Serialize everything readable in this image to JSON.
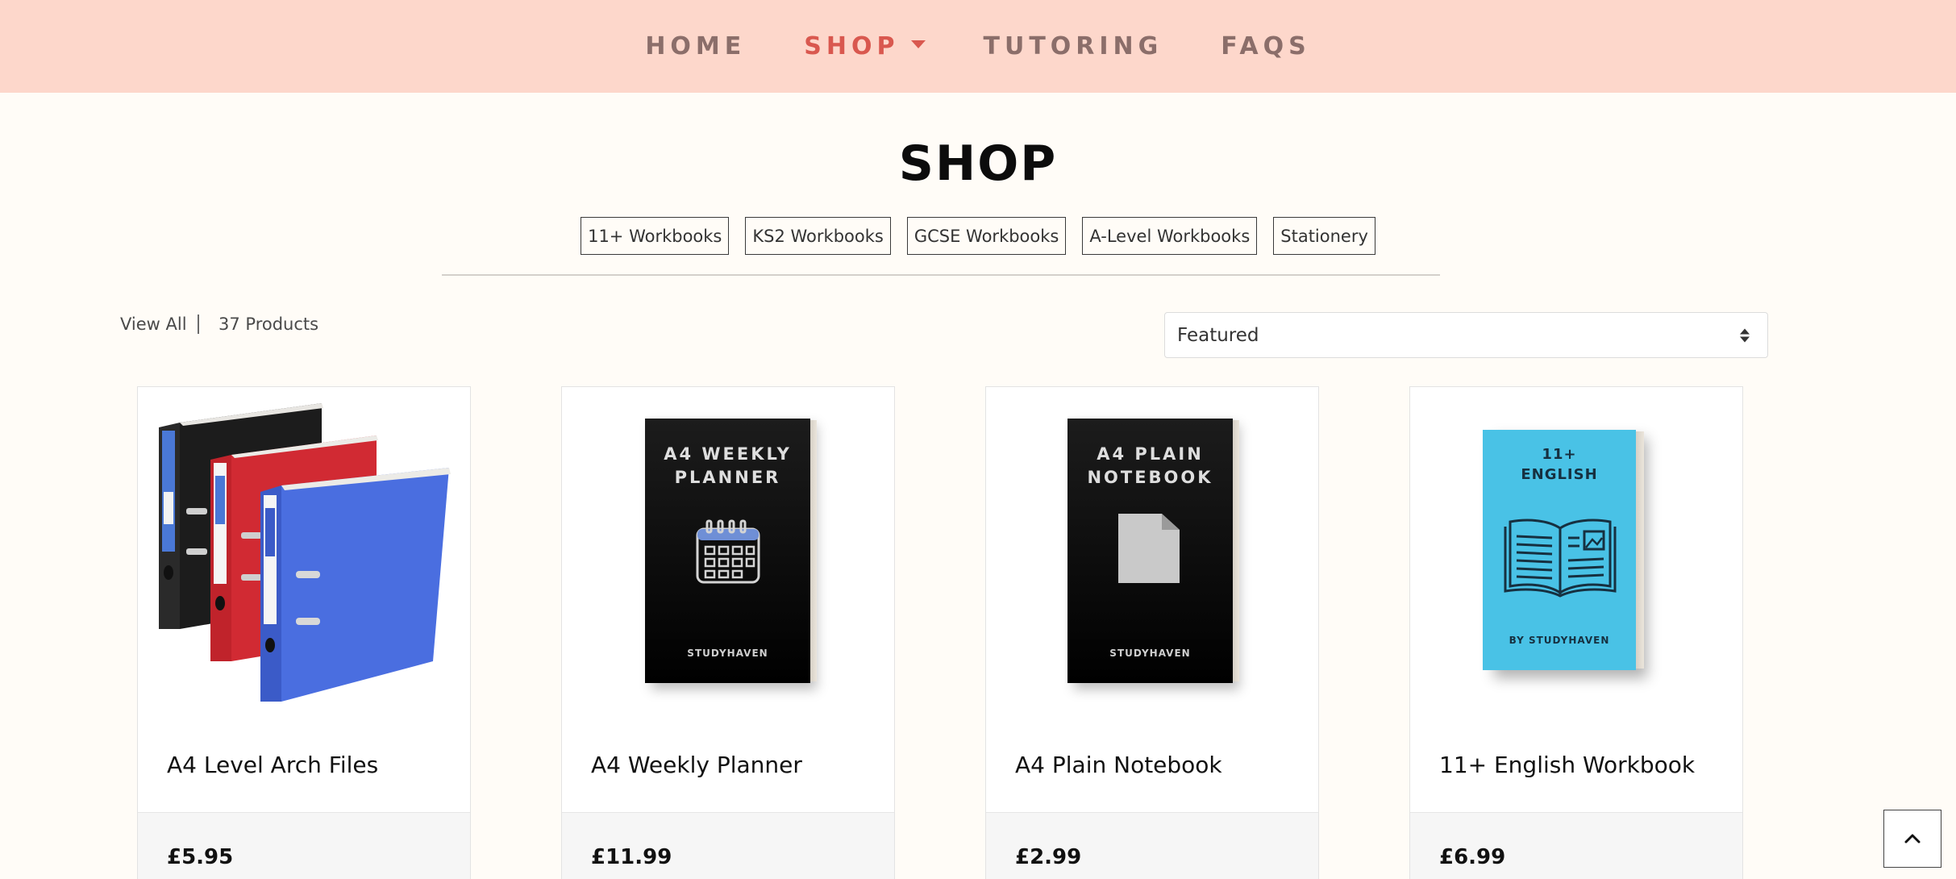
{
  "nav": {
    "items": [
      {
        "label": "HOME"
      },
      {
        "label": "SHOP"
      },
      {
        "label": "TUTORING"
      },
      {
        "label": "FAQS"
      }
    ],
    "active": "SHOP"
  },
  "page": {
    "title": "SHOP"
  },
  "categories": [
    "11+ Workbooks",
    "KS2 Workbooks",
    "GCSE Workbooks",
    "A-Level Workbooks",
    "Stationery"
  ],
  "toolbar": {
    "view_all": "View All",
    "product_count": "37 Products",
    "sort_value": "Featured"
  },
  "products": [
    {
      "name": "A4 Level Arch Files",
      "price": "£5.95",
      "image": "arch-files-icon"
    },
    {
      "name": "A4 Weekly Planner",
      "price": "£11.99",
      "image": "planner-cover",
      "cover_title_1": "A4 WEEKLY",
      "cover_title_2": "PLANNER",
      "cover_brand": "STUDYHAVEN"
    },
    {
      "name": "A4 Plain Notebook",
      "price": "£2.99",
      "image": "notebook-cover",
      "cover_title_1": "A4 PLAIN",
      "cover_title_2": "NOTEBOOK",
      "cover_brand": "STUDYHAVEN"
    },
    {
      "name": "11+ English Workbook",
      "price": "£6.99",
      "image": "english-workbook-cover",
      "cover_title_1": "11+",
      "cover_title_2": "ENGLISH",
      "cover_brand": "BY STUDYHAVEN"
    }
  ],
  "colors": {
    "nav_bg": "#fdd7cb",
    "nav_text": "#8b6e6a",
    "nav_active": "#d9584f",
    "page_bg": "#fffcf7"
  }
}
